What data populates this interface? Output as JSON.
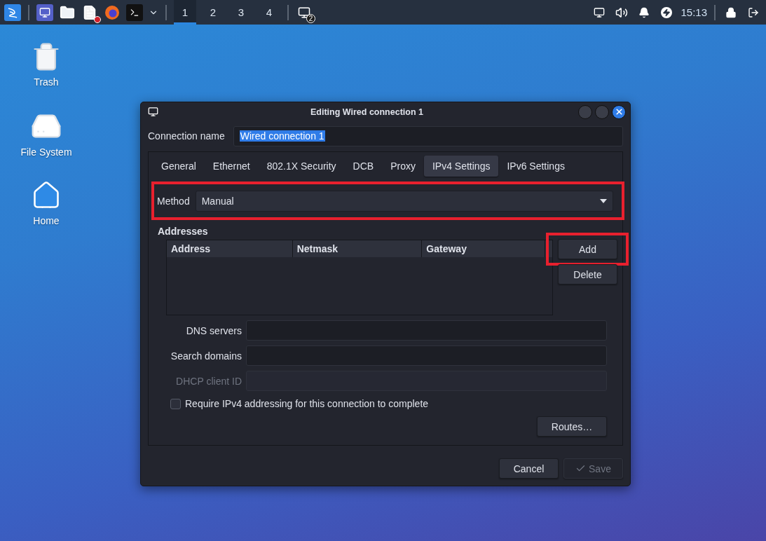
{
  "taskbar": {
    "launchers": [
      {
        "kind": "logo"
      },
      {
        "kind": "screen"
      },
      {
        "kind": "folder"
      },
      {
        "kind": "document"
      },
      {
        "kind": "browser"
      },
      {
        "kind": "terminal"
      },
      {
        "kind": "chevron"
      }
    ],
    "workspaces": [
      {
        "label": "1",
        "selected": true
      },
      {
        "label": "2",
        "selected": false
      },
      {
        "label": "3",
        "selected": false
      },
      {
        "label": "4",
        "selected": false
      }
    ],
    "notification_badge": "2",
    "clock": "15:13"
  },
  "desktop_icons": [
    {
      "kind": "trash",
      "label": "Trash"
    },
    {
      "kind": "drive",
      "label": "File System"
    },
    {
      "kind": "home",
      "label": "Home"
    }
  ],
  "dialog": {
    "title": "Editing Wired connection 1",
    "connection_name": {
      "label": "Connection name",
      "value": "Wired connection 1",
      "text_selected": true
    },
    "tabs": [
      {
        "label": "General",
        "selected": false
      },
      {
        "label": "Ethernet",
        "selected": false
      },
      {
        "label": "802.1X Security",
        "selected": false
      },
      {
        "label": "DCB",
        "selected": false
      },
      {
        "label": "Proxy",
        "selected": false
      },
      {
        "label": "IPv4 Settings",
        "selected": true
      },
      {
        "label": "IPv6 Settings",
        "selected": false
      }
    ],
    "method": {
      "label": "Method",
      "value": "Manual",
      "highlighted": true
    },
    "addresses": {
      "title": "Addresses",
      "columns": [
        "Address",
        "Netmask",
        "Gateway"
      ],
      "buttons": [
        {
          "label": "Add",
          "highlighted": true
        },
        {
          "label": "Delete",
          "highlighted": false
        }
      ]
    },
    "fields": [
      {
        "label": "DNS servers",
        "disabled": false
      },
      {
        "label": "Search domains",
        "disabled": false
      },
      {
        "label": "DHCP client ID",
        "disabled": true
      }
    ],
    "require_checkbox": {
      "label": "Require IPv4 addressing for this connection to complete",
      "checked": false
    },
    "routes_button": "Routes…",
    "buttons": [
      {
        "kind": "plain",
        "label": "Cancel",
        "disabled": false
      },
      {
        "kind": "check",
        "label": "Save",
        "disabled": true
      }
    ]
  }
}
